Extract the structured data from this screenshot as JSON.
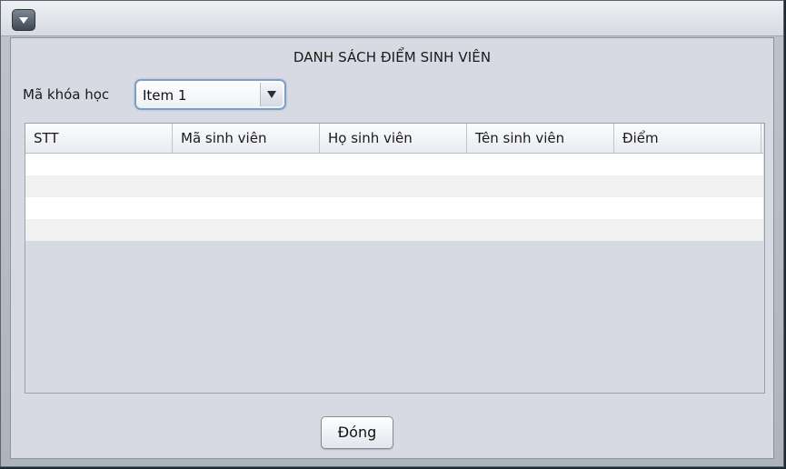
{
  "window": {
    "menu_icon": "triangle-down-icon"
  },
  "heading": "DANH SÁCH ĐIỂM SINH VIÊN",
  "course": {
    "label": "Mã khóa học",
    "selected": "Item 1",
    "arrow_icon": "triangle-down-icon"
  },
  "table": {
    "columns": [
      "STT",
      "Mã sinh viên",
      "Họ sinh viên",
      "Tên sinh viên",
      "Điểm"
    ],
    "rows": [
      [
        "",
        "",
        "",
        "",
        ""
      ],
      [
        "",
        "",
        "",
        "",
        ""
      ],
      [
        "",
        "",
        "",
        "",
        ""
      ],
      [
        "",
        "",
        "",
        "",
        ""
      ]
    ]
  },
  "actions": {
    "close_label": "Đóng"
  }
}
